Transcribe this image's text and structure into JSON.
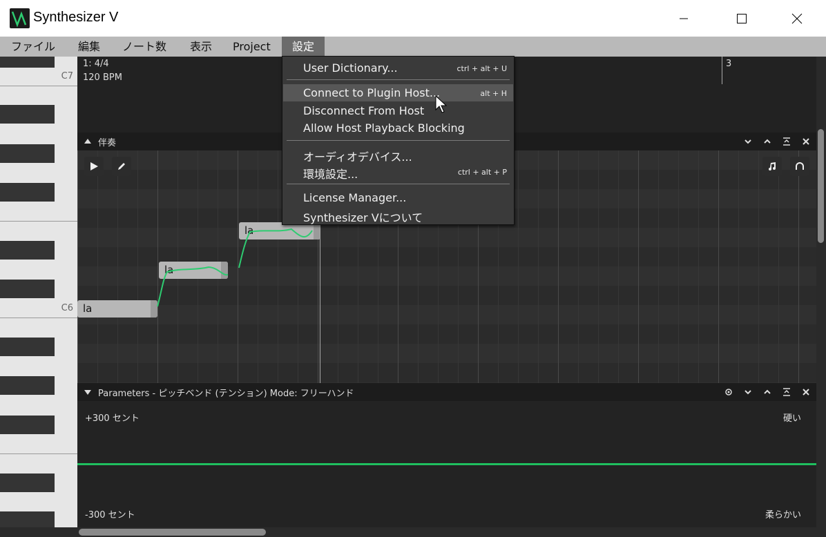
{
  "window": {
    "title": "Synthesizer V"
  },
  "menubar": [
    "ファイル",
    "編集",
    "ノート数",
    "表示",
    "Project",
    "設定"
  ],
  "dropdown": {
    "items": [
      {
        "label": "User Dictionary...",
        "shortcut": "ctrl + alt + U"
      },
      {
        "label": "Connect to Plugin Host...",
        "shortcut": "alt + H"
      },
      {
        "label": "Disconnect From Host",
        "shortcut": ""
      },
      {
        "label": "Allow Host Playback Blocking",
        "shortcut": ""
      },
      {
        "label": "オーディオデバイス...",
        "shortcut": ""
      },
      {
        "label": "環境設定...",
        "shortcut": "ctrl + alt + P"
      },
      {
        "label": "License Manager...",
        "shortcut": ""
      },
      {
        "label": "Synthesizer Vについて",
        "shortcut": ""
      }
    ]
  },
  "timeline": {
    "time_signature": "1: 4/4",
    "tempo": "120 BPM",
    "measure_3": "3"
  },
  "piano": {
    "c7": "C7",
    "c6": "C6"
  },
  "track": {
    "name": "伴奏"
  },
  "notes": [
    "la",
    "la",
    "la"
  ],
  "parameters": {
    "title": "Parameters  -  ピッチベンド (テンション) Mode: フリーハンド",
    "top_left": "+300 セント",
    "bottom_left": "-300 セント",
    "top_right": "硬い",
    "bottom_right": "柔らかい"
  },
  "colors": {
    "accent": "#2ecc71",
    "pitch_line": "#1fbf5f"
  }
}
